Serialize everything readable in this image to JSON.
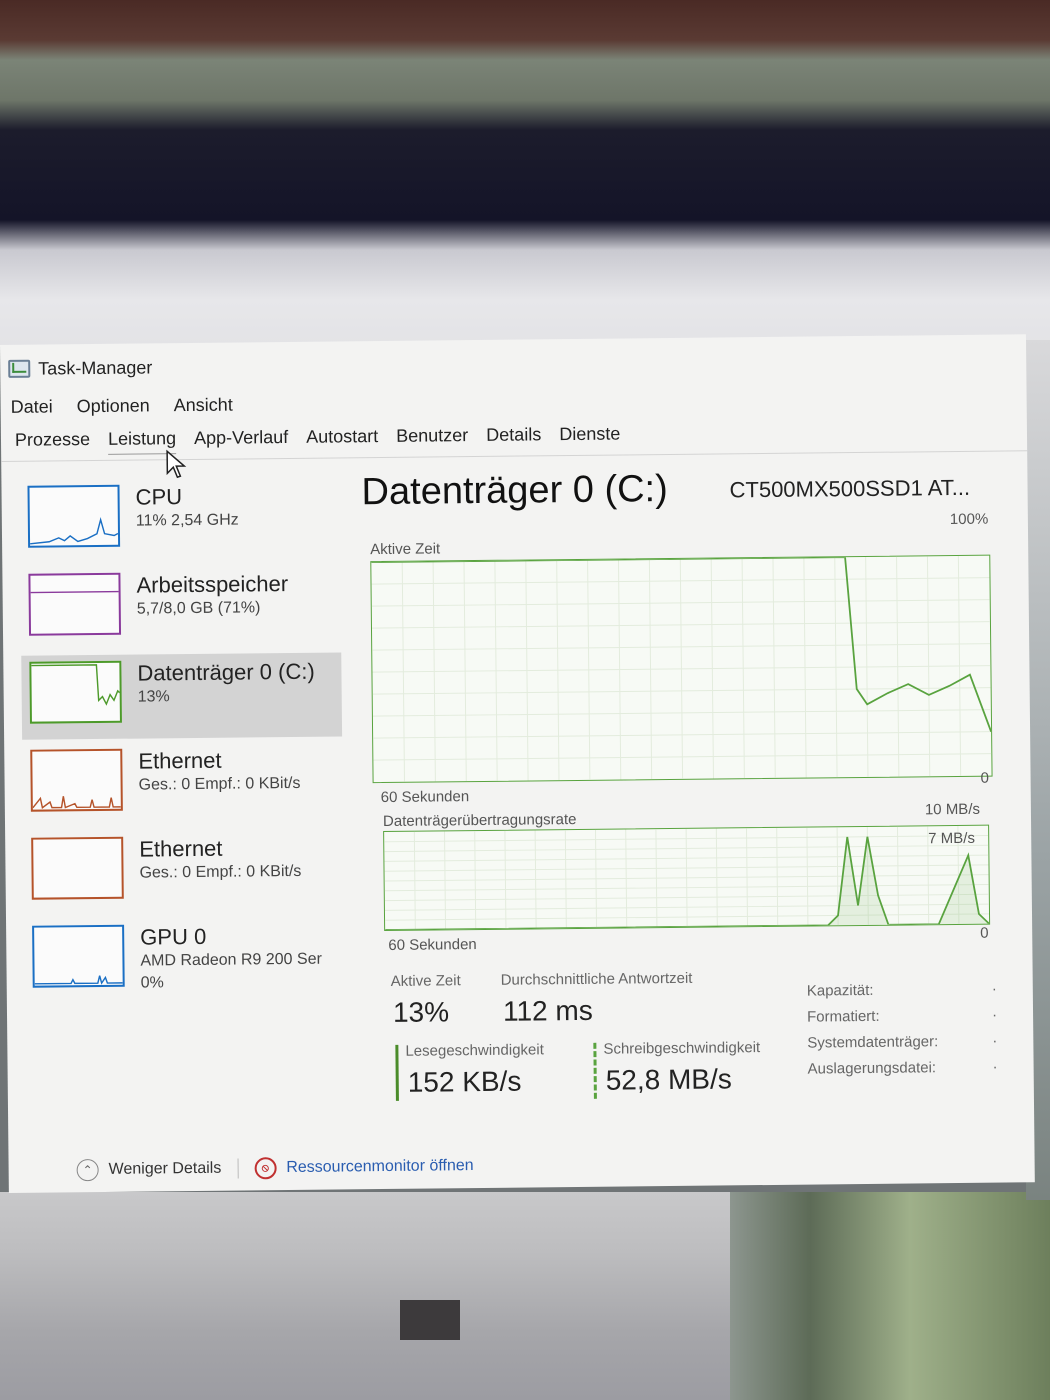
{
  "window": {
    "title": "Task-Manager"
  },
  "menu": [
    "Datei",
    "Optionen",
    "Ansicht"
  ],
  "tabs": [
    "Prozesse",
    "Leistung",
    "App-Verlauf",
    "Autostart",
    "Benutzer",
    "Details",
    "Dienste"
  ],
  "active_tab": "Leistung",
  "sidebar": [
    {
      "name": "CPU",
      "sub": "11% 2,54 GHz",
      "color": "#1a6fc4",
      "selected": false
    },
    {
      "name": "Arbeitsspeicher",
      "sub": "5,7/8,0 GB (71%)",
      "color": "#8a3a9c",
      "selected": false
    },
    {
      "name": "Datenträger 0 (C:)",
      "sub": "13%",
      "color": "#4d9a2a",
      "selected": true
    },
    {
      "name": "Ethernet",
      "sub": "Ges.: 0 Empf.: 0 KBit/s",
      "color": "#b5532a",
      "selected": false
    },
    {
      "name": "Ethernet",
      "sub": "Ges.: 0 Empf.: 0 KBit/s",
      "color": "#b5532a",
      "selected": false
    },
    {
      "name": "GPU 0",
      "sub": "AMD Radeon R9 200 Ser",
      "sub2": "0%",
      "color": "#1a6fc4",
      "selected": false
    }
  ],
  "detail": {
    "title": "Datenträger 0 (C:)",
    "model": "CT500MX500SSD1 AT...",
    "graph1": {
      "label": "Aktive Zeit",
      "max": "100%",
      "span": "60 Sekunden",
      "min": "0"
    },
    "graph2": {
      "label": "Datenträgerübertragungsrate",
      "max": "10 MB/s",
      "inner_max": "7 MB/s",
      "span": "60 Sekunden",
      "min": "0"
    },
    "stats": {
      "active_time_label": "Aktive Zeit",
      "active_time": "13%",
      "response_label": "Durchschnittliche Antwortzeit",
      "response": "112 ms",
      "read_label": "Lesegeschwindigkeit",
      "read": "152 KB/s",
      "write_label": "Schreibgeschwindigkeit",
      "write": "52,8 MB/s"
    },
    "properties": [
      {
        "label": "Kapazität:",
        "value": "·"
      },
      {
        "label": "Formatiert:",
        "value": "·"
      },
      {
        "label": "Systemdatenträger:",
        "value": "·"
      },
      {
        "label": "Auslagerungsdatei:",
        "value": "·"
      }
    ]
  },
  "footer": {
    "less_details": "Weniger Details",
    "resource_monitor": "Ressourcenmonitor öffnen"
  },
  "chart_data": [
    {
      "type": "line",
      "title": "Aktive Zeit",
      "ylim": [
        0,
        100
      ],
      "x": [
        0,
        15,
        30,
        45,
        46,
        47,
        48,
        50,
        52,
        54,
        56,
        58,
        60
      ],
      "values": [
        100,
        100,
        100,
        100,
        100,
        40,
        33,
        38,
        42,
        37,
        41,
        46,
        20
      ]
    },
    {
      "type": "line",
      "title": "Datenträgerübertragungsrate",
      "ylim": [
        0,
        10
      ],
      "x": [
        0,
        44,
        45,
        46,
        47,
        48,
        49,
        50,
        55,
        58,
        59,
        60
      ],
      "values": [
        0,
        0,
        1,
        9,
        2,
        9,
        3,
        0,
        0,
        7,
        1,
        0
      ]
    }
  ]
}
